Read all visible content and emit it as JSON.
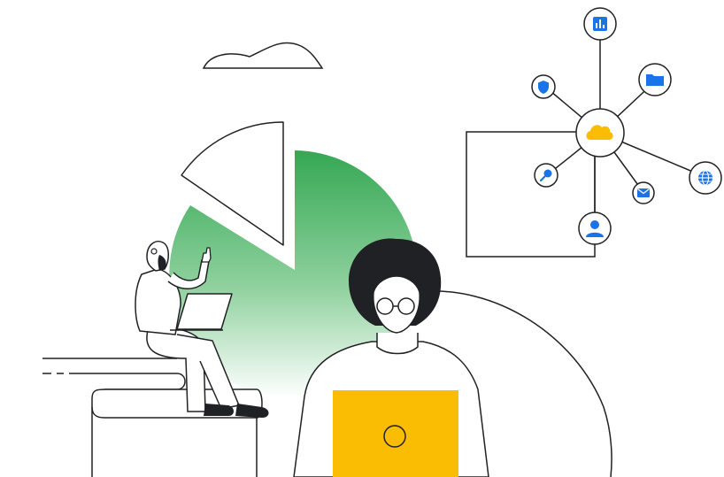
{
  "illustration": {
    "pie_slices": 2,
    "hub_nodes": 7,
    "hub_icons": [
      "cloud-icon",
      "bar-chart-icon",
      "folder-icon",
      "shield-icon",
      "search-icon",
      "mail-icon",
      "globe-icon",
      "person-icon"
    ]
  },
  "colors": {
    "stroke": "#202124",
    "green": "#34a853",
    "green_light": "#e6f4ea",
    "yellow": "#fbbc04",
    "blue": "#4285f4",
    "blue_dark": "#1a73e8",
    "hair": "#202124",
    "white": "#ffffff"
  }
}
